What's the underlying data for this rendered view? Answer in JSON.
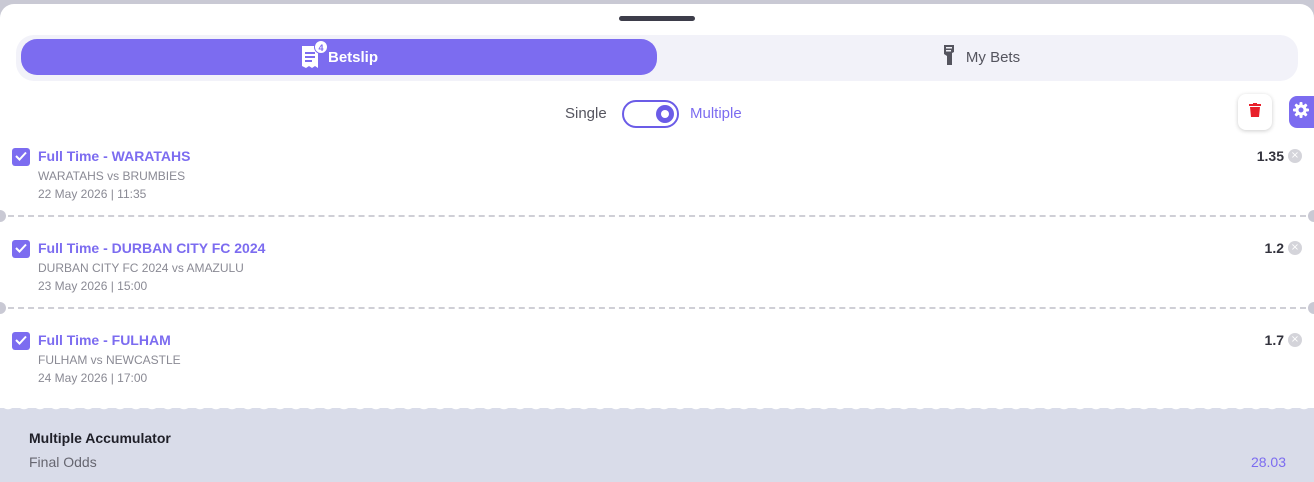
{
  "tabs": {
    "betslip_label": "Betslip",
    "betslip_count": "4",
    "mybets_label": "My Bets"
  },
  "mode": {
    "single_label": "Single",
    "multiple_label": "Multiple",
    "selected": "Multiple"
  },
  "bets": [
    {
      "title": "Full Time - WARATAHS",
      "match": "WARATAHS vs BRUMBIES",
      "datetime": "22 May 2026 | 11:35",
      "odds": "1.35",
      "checked": true
    },
    {
      "title": "Full Time - DURBAN CITY FC 2024",
      "match": "DURBAN CITY FC 2024 vs AMAZULU",
      "datetime": "23 May 2026 | 15:00",
      "odds": "1.2",
      "checked": true
    },
    {
      "title": "Full Time - FULHAM",
      "match": "FULHAM vs NEWCASTLE",
      "datetime": "24 May 2026 | 17:00",
      "odds": "1.7",
      "checked": true
    }
  ],
  "summary": {
    "title": "Multiple Accumulator",
    "final_odds_label": "Final Odds",
    "final_odds_value": "28.03"
  },
  "icons": {
    "betslip": "receipt-icon",
    "mybets": "ticket-hand-icon",
    "trash": "trash-icon",
    "settings": "gear-icon",
    "check": "check-icon",
    "remove": "close-circle-icon"
  },
  "colors": {
    "accent": "#7c6cf0",
    "trash": "#e8202a",
    "summary_bg": "#d9dce9"
  }
}
